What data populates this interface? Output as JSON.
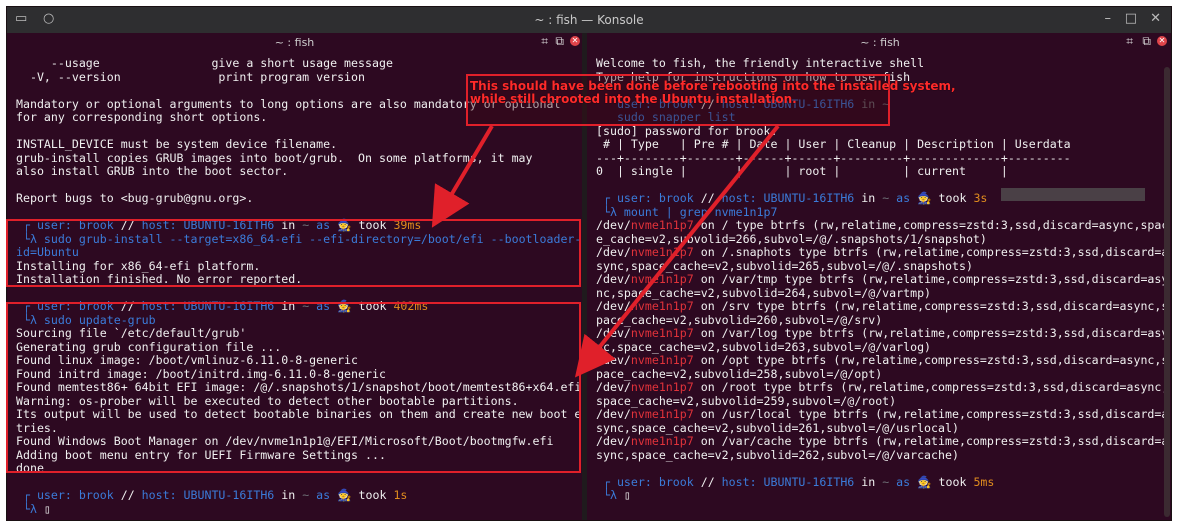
{
  "window": {
    "title": "~ : fish — Konsole"
  },
  "left_pane": {
    "title": "~ : fish",
    "lines": [
      [
        {
          "t": "     --usage                give a short usage message"
        }
      ],
      [
        {
          "t": "  -V, --version              print program version"
        }
      ],
      [
        {
          "t": ""
        }
      ],
      [
        {
          "t": "Mandatory or optional arguments to long options are also mandatory or optional"
        }
      ],
      [
        {
          "t": "for any corresponding short options."
        }
      ],
      [
        {
          "t": ""
        }
      ],
      [
        {
          "t": "INSTALL_DEVICE must be system device filename."
        }
      ],
      [
        {
          "t": "grub-install copies GRUB images into boot/grub.  On some platforms, it may"
        }
      ],
      [
        {
          "t": "also install GRUB into the boot sector."
        }
      ],
      [
        {
          "t": ""
        }
      ],
      [
        {
          "t": "Report bugs to <bug-grub@gnu.org>."
        }
      ],
      [
        {
          "t": ""
        }
      ],
      [
        {
          "t": " ┌ ",
          "c": "blue"
        },
        {
          "t": "user: brook",
          "c": "blue"
        },
        {
          "t": " // ",
          "c": ""
        },
        {
          "t": "host: UBUNTU-16ITH6",
          "c": "blue"
        },
        {
          "t": " in ",
          "c": ""
        },
        {
          "t": "~",
          "c": "dim"
        },
        {
          "t": " as ",
          "c": "blue"
        },
        {
          "t": "🧙 ",
          "c": ""
        },
        {
          "t": "took ",
          "c": ""
        },
        {
          "t": "39ms",
          "c": "orange"
        }
      ],
      [
        {
          "t": " └λ ",
          "c": "blue"
        },
        {
          "t": "sudo grub-install --target=x86_64-efi --efi-directory=/boot/efi --bootloader-",
          "c": "blue"
        }
      ],
      [
        {
          "t": "id=Ubuntu",
          "c": "blue"
        }
      ],
      [
        {
          "t": "Installing for x86_64-efi platform."
        }
      ],
      [
        {
          "t": "Installation finished. No error reported."
        }
      ],
      [
        {
          "t": ""
        }
      ],
      [
        {
          "t": " ┌ ",
          "c": "blue"
        },
        {
          "t": "user: brook",
          "c": "blue"
        },
        {
          "t": " // ",
          "c": ""
        },
        {
          "t": "host: UBUNTU-16ITH6",
          "c": "blue"
        },
        {
          "t": " in ",
          "c": ""
        },
        {
          "t": "~",
          "c": "dim"
        },
        {
          "t": " as ",
          "c": "blue"
        },
        {
          "t": "🧙 ",
          "c": ""
        },
        {
          "t": "took ",
          "c": ""
        },
        {
          "t": "402ms",
          "c": "orange"
        }
      ],
      [
        {
          "t": " └λ ",
          "c": "blue"
        },
        {
          "t": "sudo update-grub",
          "c": "blue"
        }
      ],
      [
        {
          "t": "Sourcing file `/etc/default/grub'"
        }
      ],
      [
        {
          "t": "Generating grub configuration file ..."
        }
      ],
      [
        {
          "t": "Found linux image: /boot/vmlinuz-6.11.0-8-generic"
        }
      ],
      [
        {
          "t": "Found initrd image: /boot/initrd.img-6.11.0-8-generic"
        }
      ],
      [
        {
          "t": "Found memtest86+ 64bit EFI image: /@/.snapshots/1/snapshot/boot/memtest86+x64.efi"
        }
      ],
      [
        {
          "t": "Warning: os-prober will be executed to detect other bootable partitions."
        }
      ],
      [
        {
          "t": "Its output will be used to detect bootable binaries on them and create new boot en"
        }
      ],
      [
        {
          "t": "tries."
        }
      ],
      [
        {
          "t": "Found Windows Boot Manager on /dev/nvme1n1p1@/EFI/Microsoft/Boot/bootmgfw.efi"
        }
      ],
      [
        {
          "t": "Adding boot menu entry for UEFI Firmware Settings ..."
        }
      ],
      [
        {
          "t": "done"
        }
      ],
      [
        {
          "t": ""
        }
      ],
      [
        {
          "t": " ┌ ",
          "c": "blue"
        },
        {
          "t": "user: brook",
          "c": "blue"
        },
        {
          "t": " // ",
          "c": ""
        },
        {
          "t": "host: UBUNTU-16ITH6",
          "c": "blue"
        },
        {
          "t": " in ",
          "c": ""
        },
        {
          "t": "~",
          "c": "dim"
        },
        {
          "t": " as ",
          "c": "blue"
        },
        {
          "t": "🧙 ",
          "c": ""
        },
        {
          "t": "took ",
          "c": ""
        },
        {
          "t": "1s",
          "c": "orange"
        }
      ],
      [
        {
          "t": " └λ ",
          "c": "blue"
        },
        {
          "t": "▯",
          "c": ""
        }
      ]
    ]
  },
  "right_pane": {
    "title": "~ : fish",
    "lines": [
      [
        {
          "t": "Welcome to fish, the friendly interactive shell"
        }
      ],
      [
        {
          "t": "Type help for instructions on how to use fish"
        }
      ],
      [
        {
          "t": ""
        }
      ],
      [
        {
          "t": "   ",
          "c": ""
        },
        {
          "t": "user: brook",
          "c": "blue"
        },
        {
          "t": " // ",
          "c": ""
        },
        {
          "t": "host: UBUNTU-16ITH6",
          "c": "blue"
        },
        {
          "t": " in ~",
          "c": "dim"
        }
      ],
      [
        {
          "t": "   sudo snapper list",
          "c": "blue"
        }
      ],
      [
        {
          "t": "[sudo] password for brook:"
        }
      ],
      [
        {
          "t": " # | Type   | Pre # | Date | User | Cleanup | Description | Userdata"
        }
      ],
      [
        {
          "t": "---+--------+-------+------+------+---------+-------------+---------"
        }
      ],
      [
        {
          "t": "0  | single |       |      | root |         | current     |"
        }
      ],
      [
        {
          "t": ""
        }
      ],
      [
        {
          "t": " ┌ ",
          "c": "blue"
        },
        {
          "t": "user: brook",
          "c": "blue"
        },
        {
          "t": " // ",
          "c": ""
        },
        {
          "t": "host: UBUNTU-16ITH6",
          "c": "blue"
        },
        {
          "t": " in ",
          "c": ""
        },
        {
          "t": "~",
          "c": "dim"
        },
        {
          "t": " as ",
          "c": "blue"
        },
        {
          "t": "🧙 ",
          "c": ""
        },
        {
          "t": "took ",
          "c": ""
        },
        {
          "t": "3s",
          "c": "orange"
        }
      ],
      [
        {
          "t": " └λ ",
          "c": "blue"
        },
        {
          "t": "mount | grep nvme1n1p7",
          "c": "blue"
        }
      ],
      [
        {
          "t": "/dev/"
        },
        {
          "t": "nvme1n1p7",
          "c": "red"
        },
        {
          "t": " on / type btrfs (rw,relatime,compress=zstd:3,ssd,discard=async,spac"
        }
      ],
      [
        {
          "t": "e_cache=v2,subvolid=266,subvol=/@/.snapshots/1/snapshot)"
        }
      ],
      [
        {
          "t": "/dev/"
        },
        {
          "t": "nvme1n1p7",
          "c": "red"
        },
        {
          "t": " on /.snaphots type btrfs (rw,relatime,compress=zstd:3,ssd,discard=a"
        }
      ],
      [
        {
          "t": "sync,space_cache=v2,subvolid=265,subvol=/@/.snapshots)"
        }
      ],
      [
        {
          "t": "/dev/"
        },
        {
          "t": "nvme1n1p7",
          "c": "red"
        },
        {
          "t": " on /var/tmp type btrfs (rw,relatime,compress=zstd:3,ssd,discard=asy"
        }
      ],
      [
        {
          "t": "nc,space_cache=v2,subvolid=264,subvol=/@/vartmp)"
        }
      ],
      [
        {
          "t": "/dev/"
        },
        {
          "t": "nvme1n1p7",
          "c": "red"
        },
        {
          "t": " on /srv type btrfs (rw,relatime,compress=zstd:3,ssd,discard=async,s"
        }
      ],
      [
        {
          "t": "pace_cache=v2,subvolid=260,subvol=/@/srv)"
        }
      ],
      [
        {
          "t": "/dev/"
        },
        {
          "t": "nvme1n1p7",
          "c": "red"
        },
        {
          "t": " on /var/log type btrfs (rw,relatime,compress=zstd:3,ssd,discard=asy"
        }
      ],
      [
        {
          "t": "nc,space_cache=v2,subvolid=263,subvol=/@/varlog)"
        }
      ],
      [
        {
          "t": "/dev/"
        },
        {
          "t": "nvme1n1p7",
          "c": "red"
        },
        {
          "t": " on /opt type btrfs (rw,relatime,compress=zstd:3,ssd,discard=async,s"
        }
      ],
      [
        {
          "t": "pace_cache=v2,subvolid=258,subvol=/@/opt)"
        }
      ],
      [
        {
          "t": "/dev/"
        },
        {
          "t": "nvme1n1p7",
          "c": "red"
        },
        {
          "t": " on /root type btrfs (rw,relatime,compress=zstd:3,ssd,discard=async,"
        }
      ],
      [
        {
          "t": "space_cache=v2,subvolid=259,subvol=/@/root)"
        }
      ],
      [
        {
          "t": "/dev/"
        },
        {
          "t": "nvme1n1p7",
          "c": "red"
        },
        {
          "t": " on /usr/local type btrfs (rw,relatime,compress=zstd:3,ssd,discard=a"
        }
      ],
      [
        {
          "t": "sync,space_cache=v2,subvolid=261,subvol=/@/usrlocal)"
        }
      ],
      [
        {
          "t": "/dev/"
        },
        {
          "t": "nvme1n1p7",
          "c": "red"
        },
        {
          "t": " on /var/cache type btrfs (rw,relatime,compress=zstd:3,ssd,discard=a"
        }
      ],
      [
        {
          "t": "sync,space_cache=v2,subvolid=262,subvol=/@/varcache)"
        }
      ],
      [
        {
          "t": ""
        }
      ],
      [
        {
          "t": " ┌ ",
          "c": "blue"
        },
        {
          "t": "user: brook",
          "c": "blue"
        },
        {
          "t": " // ",
          "c": ""
        },
        {
          "t": "host: UBUNTU-16ITH6",
          "c": "blue"
        },
        {
          "t": " in ",
          "c": ""
        },
        {
          "t": "~",
          "c": "dim"
        },
        {
          "t": " as ",
          "c": "blue"
        },
        {
          "t": "🧙 ",
          "c": ""
        },
        {
          "t": "took ",
          "c": ""
        },
        {
          "t": "5ms",
          "c": "orange"
        }
      ],
      [
        {
          "t": " └λ ",
          "c": "blue"
        },
        {
          "t": "▯",
          "c": ""
        }
      ]
    ]
  },
  "annotation": {
    "line1": "This should have been done before rebooting into the installed system,",
    "line2": "while still chrooted into the Ubuntu installation."
  },
  "colors": {
    "accent_red": "#e0202a",
    "prompt_blue": "#3b7bd9",
    "time_orange": "#e08c1e"
  }
}
